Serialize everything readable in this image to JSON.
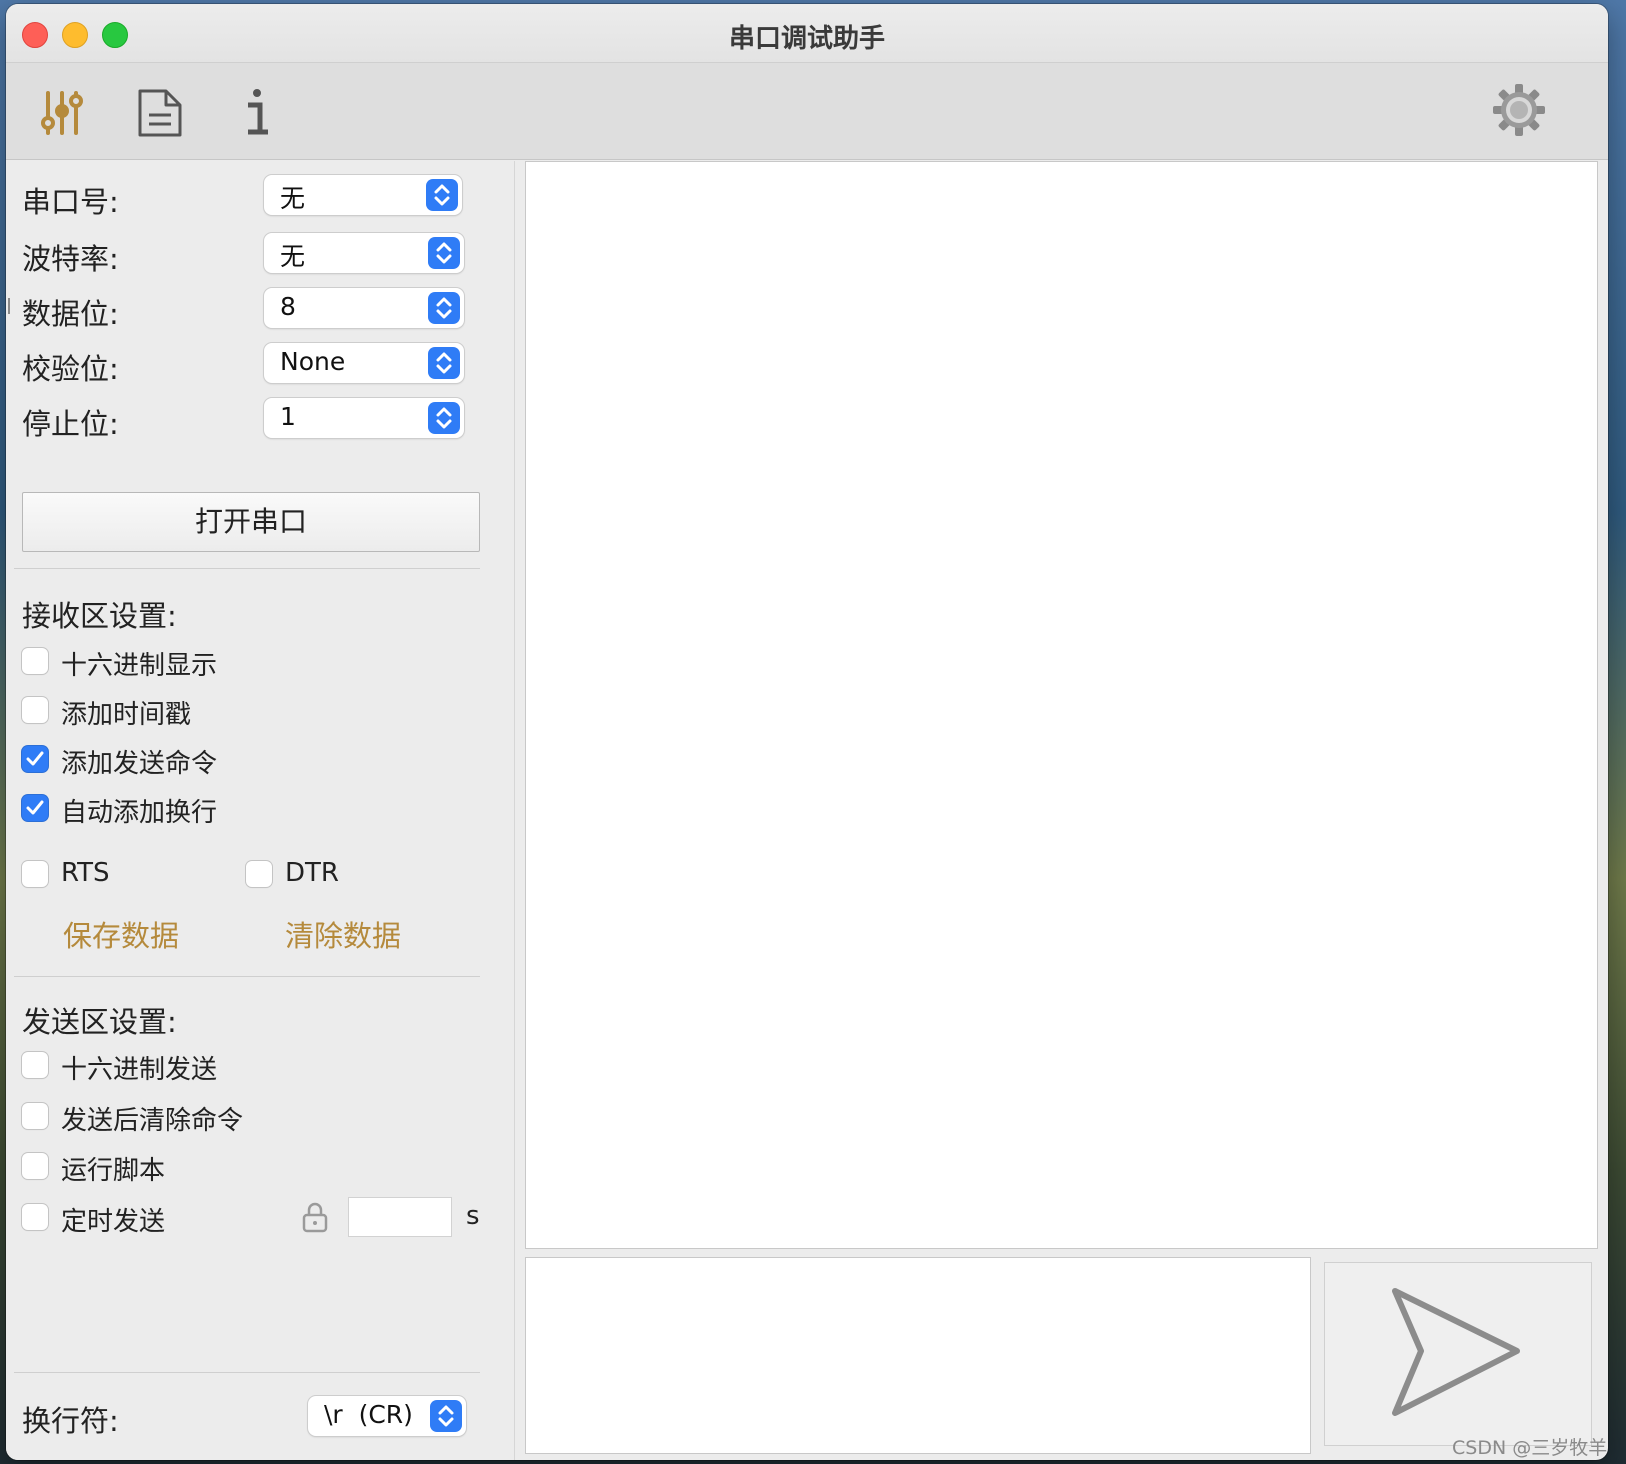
{
  "window": {
    "title": "串口调试助手"
  },
  "toolbar": {
    "icons": [
      "sliders-icon",
      "document-icon",
      "info-icon",
      "gear-icon"
    ],
    "accent_color": "#b58a3c"
  },
  "serial_settings": {
    "port": {
      "label": "串口号:",
      "value": "无"
    },
    "baud": {
      "label": "波特率:",
      "value": "无"
    },
    "data_bits": {
      "label": "数据位:",
      "value": "8"
    },
    "parity": {
      "label": "校验位:",
      "value": "None"
    },
    "stop_bits": {
      "label": "停止位:",
      "value": "1"
    },
    "open_button": "打开串口"
  },
  "receive_settings": {
    "heading": "接收区设置:",
    "options": [
      {
        "label": "十六进制显示",
        "checked": false
      },
      {
        "label": "添加时间戳",
        "checked": false
      },
      {
        "label": "添加发送命令",
        "checked": true
      },
      {
        "label": "自动添加换行",
        "checked": true
      }
    ],
    "rts": {
      "label": "RTS",
      "checked": false
    },
    "dtr": {
      "label": "DTR",
      "checked": false
    },
    "save_link": "保存数据",
    "clear_link": "清除数据"
  },
  "send_settings": {
    "heading": "发送区设置:",
    "options": [
      {
        "label": "十六进制发送",
        "checked": false
      },
      {
        "label": "发送后清除命令",
        "checked": false
      },
      {
        "label": "运行脚本",
        "checked": false
      },
      {
        "label": "定时发送",
        "checked": false
      }
    ],
    "timer_value": "",
    "timer_unit": "s"
  },
  "line_ending": {
    "label": "换行符:",
    "value": "\\r  (CR)"
  },
  "colors": {
    "checkbox_on": "#2f7cf6",
    "link": "#b58a3c",
    "stepper": "#2f7cf6"
  },
  "watermark": "CSDN @三岁牧羊"
}
